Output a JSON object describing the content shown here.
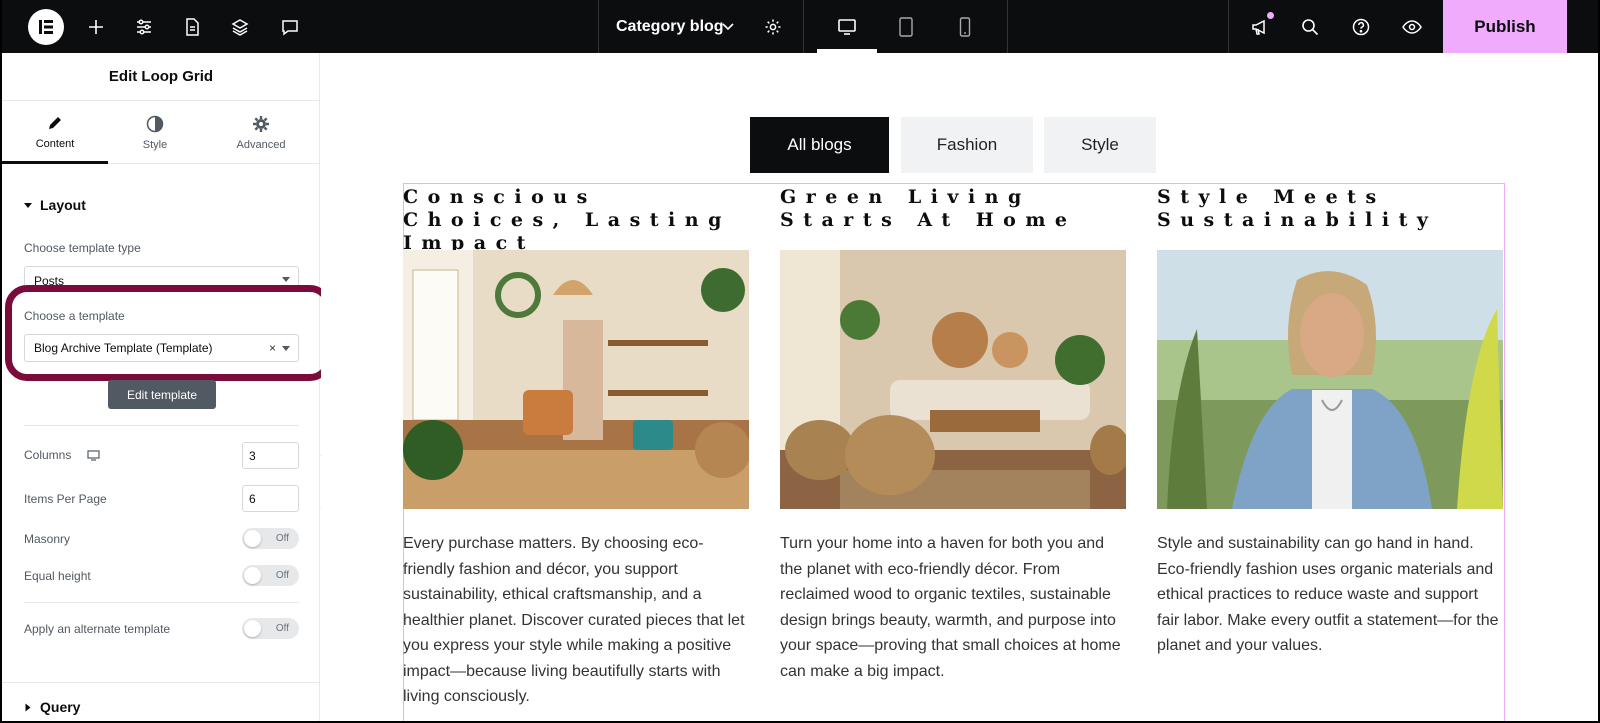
{
  "topbar": {
    "page_name": "Category blog",
    "publish_label": "Publish",
    "accent": "#f0abfc"
  },
  "sidebar": {
    "title": "Edit Loop Grid",
    "tabs": [
      {
        "label": "Content",
        "icon": "pencil-icon"
      },
      {
        "label": "Style",
        "icon": "contrast-icon"
      },
      {
        "label": "Advanced",
        "icon": "gear-icon"
      }
    ],
    "section": "Layout",
    "template_type_label": "Choose template type",
    "template_type_value": "Posts",
    "template_label": "Choose a template",
    "template_value": "Blog Archive Template (Template)",
    "edit_template_label": "Edit template",
    "columns_label": "Columns",
    "columns_value": "3",
    "items_per_page_label": "Items Per Page",
    "items_per_page_value": "6",
    "masonry_label": "Masonry",
    "equal_height_label": "Equal height",
    "alternate_label": "Apply an alternate template",
    "toggle_off": "Off",
    "next_section": "Query",
    "highlight_color": "#7a0b3a"
  },
  "canvas": {
    "filters": [
      "All blogs",
      "Fashion",
      "Style"
    ],
    "posts": [
      {
        "title": "Conscious Choices, Lasting Impact",
        "text": "Every purchase matters. By choosing eco-friendly fashion and décor, you support sustainability, ethical craftsmanship, and a healthier planet. Discover curated pieces that let you express your style while making a positive impact—because living beautifully starts with living consciously."
      },
      {
        "title": "Green Living Starts At Home",
        "text": "Turn your home into a haven for both you and the planet with eco-friendly décor. From reclaimed wood to organic textiles, sustainable design brings beauty, warmth, and purpose into your space—proving that small choices at home can make a big impact."
      },
      {
        "title": "Style Meets Sustainability",
        "text": "Style and sustainability can go hand in hand. Eco-friendly fashion uses organic materials and ethical practices to reduce waste and support fair labor. Make every outfit a statement—for the planet and your values."
      }
    ]
  }
}
